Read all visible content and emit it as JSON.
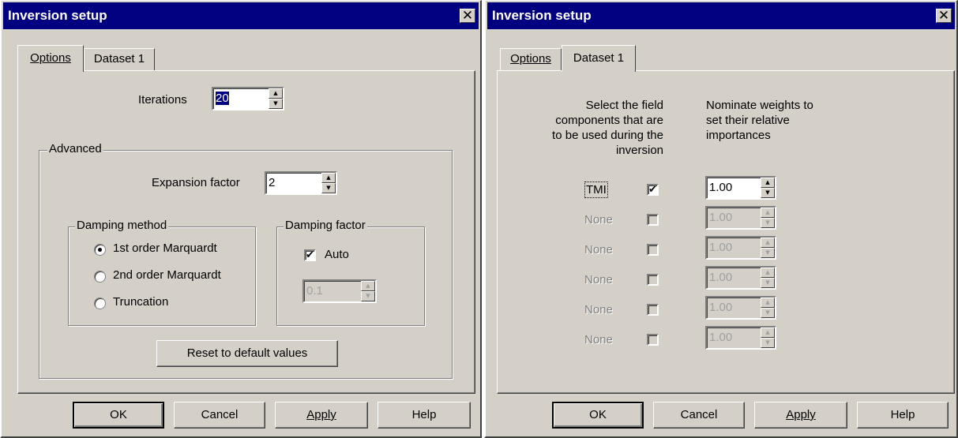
{
  "left": {
    "title": "Inversion setup",
    "close": "✕",
    "tabs": [
      {
        "label": "Options"
      },
      {
        "label": "Dataset 1"
      }
    ],
    "iterations": {
      "label": "Iterations",
      "value": "20"
    },
    "advanced": {
      "title": "Advanced",
      "expansion_label": "Expansion factor",
      "expansion_value": "2",
      "damping_method": {
        "title": "Damping method",
        "options": [
          "1st order Marquardt",
          "2nd order Marquardt",
          "Truncation"
        ]
      },
      "damping_factor": {
        "title": "Damping factor",
        "auto_label": "Auto",
        "auto_checked": true,
        "value": "0.1"
      },
      "reset_label": "Reset to default values"
    },
    "buttons": {
      "ok": "OK",
      "cancel": "Cancel",
      "apply": "Apply",
      "help": "Help"
    }
  },
  "right": {
    "title": "Inversion setup",
    "close": "✕",
    "tabs": [
      {
        "label": "Options"
      },
      {
        "label": "Dataset 1"
      }
    ],
    "col1_header": "Select the field components that are to be used during the inversion",
    "col2_header": "Nominate weights to set their relative importances",
    "rows": [
      {
        "name": "TMI",
        "checked": true,
        "weight": "1.00"
      },
      {
        "name": "None",
        "checked": false,
        "weight": "1.00"
      },
      {
        "name": "None",
        "checked": false,
        "weight": "1.00"
      },
      {
        "name": "None",
        "checked": false,
        "weight": "1.00"
      },
      {
        "name": "None",
        "checked": false,
        "weight": "1.00"
      },
      {
        "name": "None",
        "checked": false,
        "weight": "1.00"
      }
    ],
    "buttons": {
      "ok": "OK",
      "cancel": "Cancel",
      "apply": "Apply",
      "help": "Help"
    }
  }
}
